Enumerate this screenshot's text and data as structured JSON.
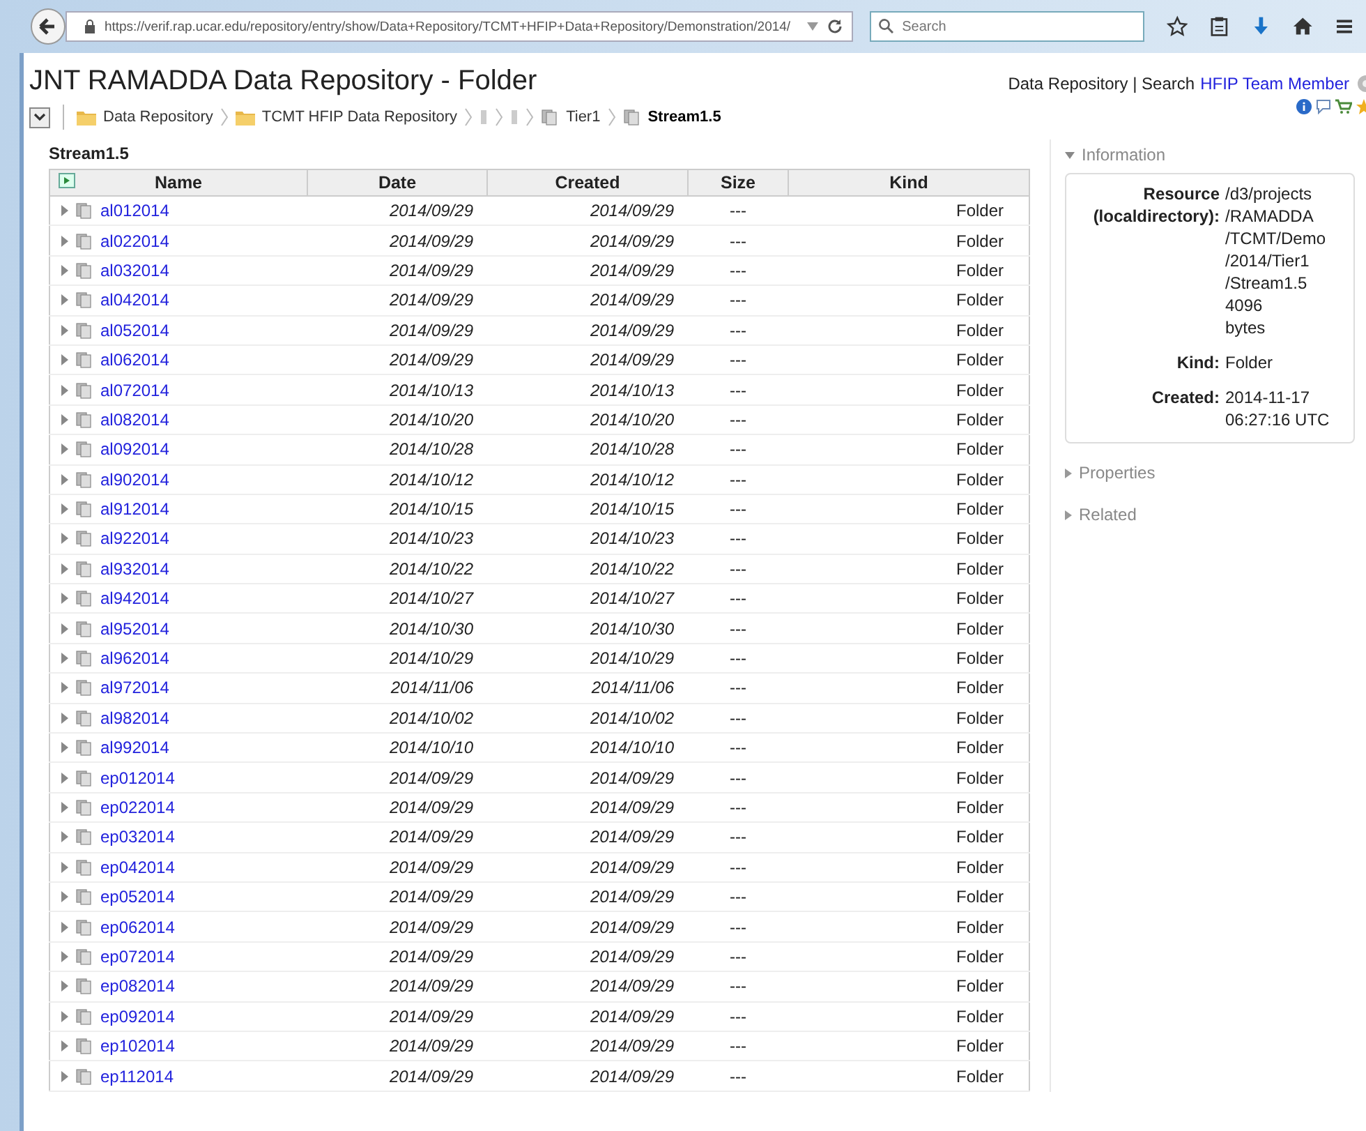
{
  "browser": {
    "url": "https://verif.rap.ucar.edu/repository/entry/show/Data+Repository/TCMT+HFIP+Data+Repository/Demonstration/2014/",
    "search_placeholder": "Search"
  },
  "page_title": "JNT RAMADDA Data Repository - Folder",
  "header_links": [
    {
      "kind": "text",
      "label": "Data Repository | Search"
    },
    {
      "kind": "link",
      "label": "HFIP Team Member"
    }
  ],
  "breadcrumbs": [
    {
      "kind": "folder",
      "label": "Data Repository",
      "current": false
    },
    {
      "kind": "folder",
      "label": "TCMT HFIP Data Repository",
      "current": false
    },
    {
      "kind": "hidden",
      "current": false
    },
    {
      "kind": "hidden",
      "current": false
    },
    {
      "kind": "group",
      "label": "Tier1",
      "current": false
    },
    {
      "kind": "group",
      "label": "Stream1.5",
      "current": true
    }
  ],
  "section_title": "Stream1.5",
  "table": {
    "columns": [
      "Name",
      "Date",
      "Created",
      "Size",
      "Kind"
    ],
    "rows": [
      {
        "name": "al012014",
        "date": "2014/09/29",
        "created": "2014/09/29",
        "size": "---",
        "kind": "Folder"
      },
      {
        "name": "al022014",
        "date": "2014/09/29",
        "created": "2014/09/29",
        "size": "---",
        "kind": "Folder"
      },
      {
        "name": "al032014",
        "date": "2014/09/29",
        "created": "2014/09/29",
        "size": "---",
        "kind": "Folder"
      },
      {
        "name": "al042014",
        "date": "2014/09/29",
        "created": "2014/09/29",
        "size": "---",
        "kind": "Folder"
      },
      {
        "name": "al052014",
        "date": "2014/09/29",
        "created": "2014/09/29",
        "size": "---",
        "kind": "Folder"
      },
      {
        "name": "al062014",
        "date": "2014/09/29",
        "created": "2014/09/29",
        "size": "---",
        "kind": "Folder"
      },
      {
        "name": "al072014",
        "date": "2014/10/13",
        "created": "2014/10/13",
        "size": "---",
        "kind": "Folder"
      },
      {
        "name": "al082014",
        "date": "2014/10/20",
        "created": "2014/10/20",
        "size": "---",
        "kind": "Folder"
      },
      {
        "name": "al092014",
        "date": "2014/10/28",
        "created": "2014/10/28",
        "size": "---",
        "kind": "Folder"
      },
      {
        "name": "al902014",
        "date": "2014/10/12",
        "created": "2014/10/12",
        "size": "---",
        "kind": "Folder"
      },
      {
        "name": "al912014",
        "date": "2014/10/15",
        "created": "2014/10/15",
        "size": "---",
        "kind": "Folder"
      },
      {
        "name": "al922014",
        "date": "2014/10/23",
        "created": "2014/10/23",
        "size": "---",
        "kind": "Folder"
      },
      {
        "name": "al932014",
        "date": "2014/10/22",
        "created": "2014/10/22",
        "size": "---",
        "kind": "Folder"
      },
      {
        "name": "al942014",
        "date": "2014/10/27",
        "created": "2014/10/27",
        "size": "---",
        "kind": "Folder"
      },
      {
        "name": "al952014",
        "date": "2014/10/30",
        "created": "2014/10/30",
        "size": "---",
        "kind": "Folder"
      },
      {
        "name": "al962014",
        "date": "2014/10/29",
        "created": "2014/10/29",
        "size": "---",
        "kind": "Folder"
      },
      {
        "name": "al972014",
        "date": "2014/11/06",
        "created": "2014/11/06",
        "size": "---",
        "kind": "Folder"
      },
      {
        "name": "al982014",
        "date": "2014/10/02",
        "created": "2014/10/02",
        "size": "---",
        "kind": "Folder"
      },
      {
        "name": "al992014",
        "date": "2014/10/10",
        "created": "2014/10/10",
        "size": "---",
        "kind": "Folder"
      },
      {
        "name": "ep012014",
        "date": "2014/09/29",
        "created": "2014/09/29",
        "size": "---",
        "kind": "Folder"
      },
      {
        "name": "ep022014",
        "date": "2014/09/29",
        "created": "2014/09/29",
        "size": "---",
        "kind": "Folder"
      },
      {
        "name": "ep032014",
        "date": "2014/09/29",
        "created": "2014/09/29",
        "size": "---",
        "kind": "Folder"
      },
      {
        "name": "ep042014",
        "date": "2014/09/29",
        "created": "2014/09/29",
        "size": "---",
        "kind": "Folder"
      },
      {
        "name": "ep052014",
        "date": "2014/09/29",
        "created": "2014/09/29",
        "size": "---",
        "kind": "Folder"
      },
      {
        "name": "ep062014",
        "date": "2014/09/29",
        "created": "2014/09/29",
        "size": "---",
        "kind": "Folder"
      },
      {
        "name": "ep072014",
        "date": "2014/09/29",
        "created": "2014/09/29",
        "size": "---",
        "kind": "Folder"
      },
      {
        "name": "ep082014",
        "date": "2014/09/29",
        "created": "2014/09/29",
        "size": "---",
        "kind": "Folder"
      },
      {
        "name": "ep092014",
        "date": "2014/09/29",
        "created": "2014/09/29",
        "size": "---",
        "kind": "Folder"
      },
      {
        "name": "ep102014",
        "date": "2014/09/29",
        "created": "2014/09/29",
        "size": "---",
        "kind": "Folder"
      },
      {
        "name": "ep112014",
        "date": "2014/09/29",
        "created": "2014/09/29",
        "size": "---",
        "kind": "Folder"
      }
    ]
  },
  "sidebar": {
    "sections": [
      {
        "title": "Information",
        "expanded": true,
        "fields": [
          {
            "label": "Resource (localdirectory):",
            "value": "/d3/projects\n/RAMADDA\n/TCMT/Demo\n/2014/Tier1\n/Stream1.5  4096\nbytes"
          },
          {
            "label": "Kind:",
            "value": "Folder"
          },
          {
            "label": "Created:",
            "value": "2014-11-17\n06:27:16 UTC"
          }
        ]
      },
      {
        "title": "Properties",
        "expanded": false
      },
      {
        "title": "Related",
        "expanded": false
      }
    ]
  }
}
